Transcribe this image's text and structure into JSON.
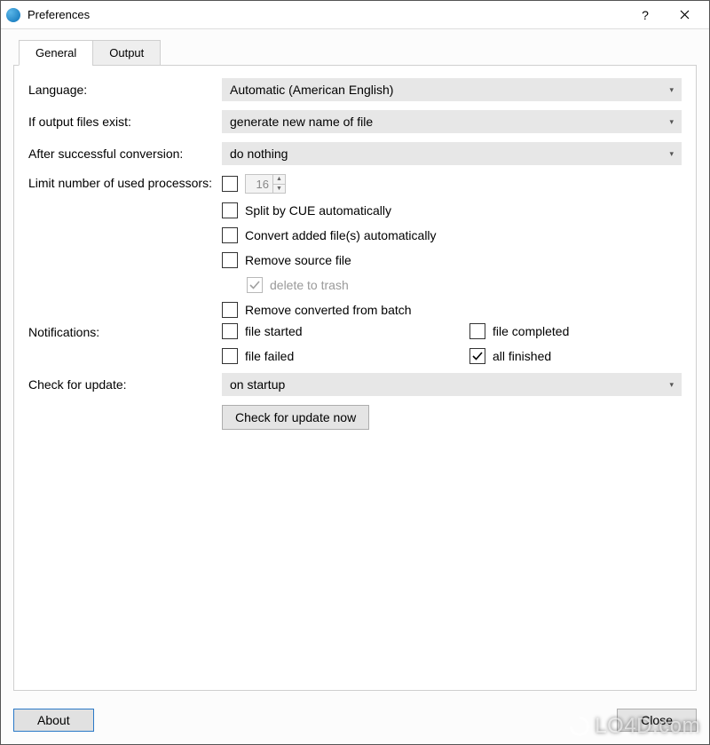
{
  "window": {
    "title": "Preferences"
  },
  "tabs": {
    "general": "General",
    "output": "Output"
  },
  "labels": {
    "language": "Language:",
    "if_exist": "If output files exist:",
    "after_conv": "After successful conversion:",
    "limit_cpu": "Limit number of used processors:",
    "notifications": "Notifications:",
    "check_update": "Check for update:"
  },
  "combos": {
    "language": "Automatic (American English)",
    "if_exist": "generate new name of file",
    "after_conv": "do nothing",
    "check_update": "on startup"
  },
  "processors": {
    "value": "16"
  },
  "checks": {
    "split_cue": "Split by CUE automatically",
    "convert_auto": "Convert added file(s) automatically",
    "remove_source": "Remove source file",
    "delete_trash": "delete to trash",
    "remove_converted": "Remove converted from batch",
    "file_started": "file started",
    "file_completed": "file completed",
    "file_failed": "file failed",
    "all_finished": "all finished"
  },
  "buttons": {
    "check_now": "Check for update now",
    "about": "About",
    "close": "Close",
    "help": "?"
  },
  "watermark": "LO4D.com"
}
